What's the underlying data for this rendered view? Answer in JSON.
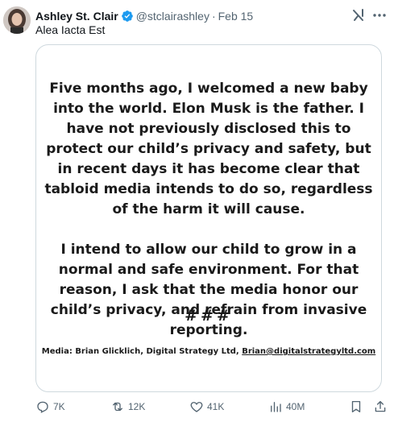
{
  "post": {
    "author_name": "Ashley St. Clair",
    "handle": "@stclairashley",
    "separator": "·",
    "date": "Feb 15",
    "text": "Alea Iacta Est"
  },
  "media_image": {
    "paragraph1": "Five months ago, I welcomed a new baby into the world. Elon Musk is the father. I have not previously disclosed this to protect our child’s privacy and safety, but in recent days it has become clear that tabloid media intends to do so, regardless of the harm it will cause.",
    "paragraph2": "I intend to allow our child to grow in a normal and safe environment. For that reason, I ask that the media honor our child’s privacy, and refrain from invasive reporting.",
    "hashes": "###",
    "contact_prefix": "Media: Brian Glicklich, Digital Strategy Ltd, ",
    "contact_email": "Brian@digitalstrategyltd.com"
  },
  "actions": {
    "replies": "7K",
    "reposts": "12K",
    "likes": "41K",
    "views": "40M"
  },
  "colors": {
    "verified": "#1d9bf0",
    "muted": "#536471",
    "border": "#cfd9de"
  },
  "icons": [
    "verified-badge-icon",
    "grok-icon",
    "more-icon",
    "reply-icon",
    "repost-icon",
    "like-icon",
    "views-icon",
    "bookmark-icon",
    "share-icon"
  ]
}
